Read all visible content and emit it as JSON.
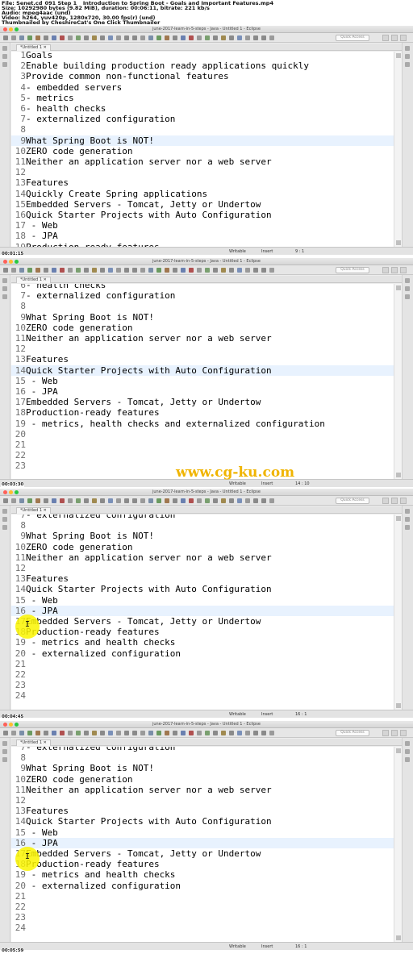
{
  "media_header": {
    "lines": [
      "File: Senet.cd_091 Step 1 _ Introduction to Spring Boot - Goals and Important Features.mp4",
      "Size: 10292980 bytes (9.82 MiB), duration: 00:06:11, bitrate: 221 kb/s",
      "Audio: mpeg4aac (und)",
      "Video: h264, yuv420p, 1280x720, 30.00 fps(r) (und)",
      "Thumbnailed by CheshireCat's One Click Thumbnailer"
    ]
  },
  "window": {
    "title": "june-2017-learn-in-5-steps - Java - Untitled 1 - Eclipse",
    "tab_label": "*Untitled 1 ✕",
    "quick_access": "Quick Access",
    "status": {
      "writable": "Writable",
      "insert": "Insert"
    },
    "traffic_colors": [
      "#ff5f57",
      "#ffbd2e",
      "#28c940"
    ]
  },
  "frames": [
    {
      "timestamp": "",
      "cursor_pos": "9 : 1",
      "highlight_line": "9",
      "lines": [
        {
          "n": "1",
          "t": "Goals"
        },
        {
          "n": "2",
          "t": "Enable building production ready applications quickly"
        },
        {
          "n": "3",
          "t": "Provide common non-functional features"
        },
        {
          "n": "4",
          "t": "- embedded servers"
        },
        {
          "n": "5",
          "t": "- metrics"
        },
        {
          "n": "6",
          "t": "- health checks"
        },
        {
          "n": "7",
          "t": "- externalized configuration"
        },
        {
          "n": "8",
          "t": ""
        },
        {
          "n": "9",
          "t": "What Spring Boot is NOT!"
        },
        {
          "n": "10",
          "t": "ZERO code generation"
        },
        {
          "n": "11",
          "t": "Neither an application server nor a web server"
        },
        {
          "n": "12",
          "t": ""
        },
        {
          "n": "13",
          "t": "Features"
        },
        {
          "n": "14",
          "t": "Quickly Create Spring applications"
        },
        {
          "n": "15",
          "t": "Embedded Servers - Tomcat, Jetty or Undertow"
        },
        {
          "n": "16",
          "t": "Quick Starter Projects with Auto Configuration"
        },
        {
          "n": "17",
          "t": " - Web"
        },
        {
          "n": "18",
          "t": " - JPA"
        },
        {
          "n": "19",
          "t": "Production-ready features"
        }
      ]
    },
    {
      "timestamp": "00:01:15",
      "cursor_pos": "14 : 10",
      "highlight_line": "14",
      "lines": [
        {
          "n": "6",
          "t": "- health checks"
        },
        {
          "n": "7",
          "t": "- externalized configuration"
        },
        {
          "n": "8",
          "t": ""
        },
        {
          "n": "9",
          "t": "What Spring Boot is NOT!"
        },
        {
          "n": "10",
          "t": "ZERO code generation"
        },
        {
          "n": "11",
          "t": "Neither an application server nor a web server"
        },
        {
          "n": "12",
          "t": ""
        },
        {
          "n": "13",
          "t": "Features"
        },
        {
          "n": "14",
          "t": "Quick Starter Projects with Auto Configuration"
        },
        {
          "n": "15",
          "t": " - Web"
        },
        {
          "n": "16",
          "t": " - JPA"
        },
        {
          "n": "17",
          "t": "Embedded Servers - Tomcat, Jetty or Undertow"
        },
        {
          "n": "18",
          "t": "Production-ready features"
        },
        {
          "n": "19",
          "t": " - metrics, health checks and externalized configuration"
        },
        {
          "n": "20",
          "t": ""
        },
        {
          "n": "21",
          "t": ""
        },
        {
          "n": "22",
          "t": ""
        },
        {
          "n": "23",
          "t": ""
        }
      ]
    },
    {
      "timestamp": "00:03:30",
      "cursor_pos": "16 : 1",
      "highlight_line": "16",
      "lines": [
        {
          "n": "7",
          "t": "- externalized configuration"
        },
        {
          "n": "8",
          "t": ""
        },
        {
          "n": "9",
          "t": "What Spring Boot is NOT!"
        },
        {
          "n": "10",
          "t": "ZERO code generation"
        },
        {
          "n": "11",
          "t": "Neither an application server nor a web server"
        },
        {
          "n": "12",
          "t": ""
        },
        {
          "n": "13",
          "t": "Features"
        },
        {
          "n": "14",
          "t": "Quick Starter Projects with Auto Configuration"
        },
        {
          "n": "15",
          "t": " - Web"
        },
        {
          "n": "16",
          "t": " - JPA"
        },
        {
          "n": "17",
          "t": "Embedded Servers - Tomcat, Jetty or Undertow"
        },
        {
          "n": "18",
          "t": "Production-ready features"
        },
        {
          "n": "19",
          "t": " - metrics and health checks"
        },
        {
          "n": "20",
          "t": " - externalized configuration"
        },
        {
          "n": "21",
          "t": ""
        },
        {
          "n": "22",
          "t": ""
        },
        {
          "n": "23",
          "t": ""
        },
        {
          "n": "24",
          "t": ""
        }
      ]
    },
    {
      "timestamp": "00:04:45",
      "cursor_pos": "16 : 1",
      "highlight_line": "16",
      "lines": [
        {
          "n": "7",
          "t": "- externalized configuration"
        },
        {
          "n": "8",
          "t": ""
        },
        {
          "n": "9",
          "t": "What Spring Boot is NOT!"
        },
        {
          "n": "10",
          "t": "ZERO code generation"
        },
        {
          "n": "11",
          "t": "Neither an application server nor a web server"
        },
        {
          "n": "12",
          "t": ""
        },
        {
          "n": "13",
          "t": "Features"
        },
        {
          "n": "14",
          "t": "Quick Starter Projects with Auto Configuration"
        },
        {
          "n": "15",
          "t": " - Web"
        },
        {
          "n": "16",
          "t": " - JPA"
        },
        {
          "n": "17",
          "t": "Embedded Servers - Tomcat, Jetty or Undertow"
        },
        {
          "n": "18",
          "t": "Production-ready features"
        },
        {
          "n": "19",
          "t": " - metrics and health checks"
        },
        {
          "n": "20",
          "t": " - externalized configuration"
        },
        {
          "n": "21",
          "t": ""
        },
        {
          "n": "22",
          "t": ""
        },
        {
          "n": "23",
          "t": ""
        },
        {
          "n": "24",
          "t": ""
        }
      ]
    }
  ],
  "end_timestamp": "00:05:59",
  "watermark": "www.cg-ku.com",
  "cursor_glyph": "I"
}
